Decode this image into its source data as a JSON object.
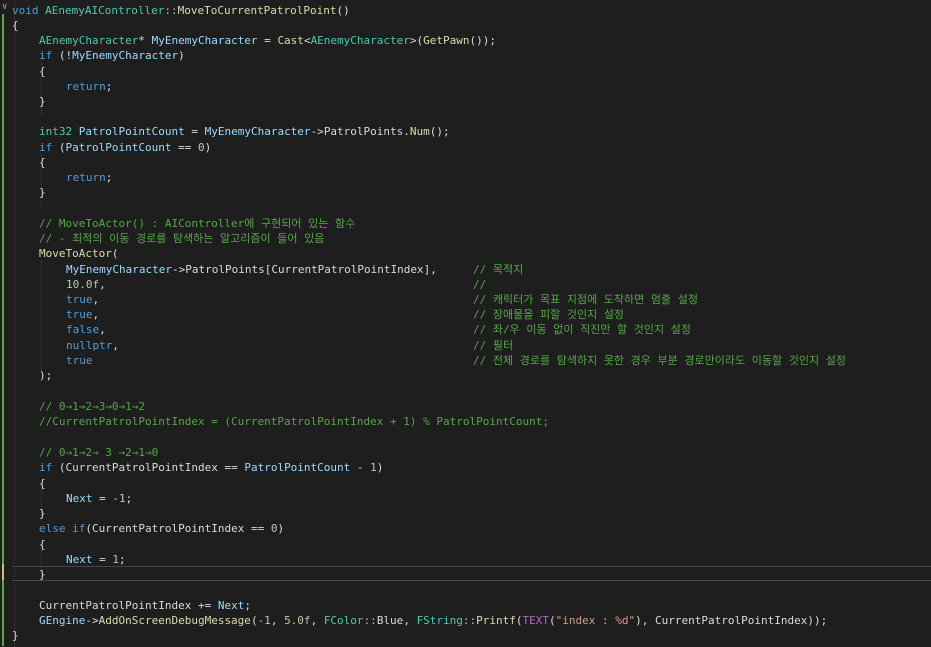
{
  "code": {
    "header": {
      "kw_void": "void",
      "class_name": "AEnemyAIController",
      "scope": "::",
      "func_name": "MoveToCurrentPatrolPoint",
      "parens": "()"
    },
    "lines": {
      "l1_brace": "{",
      "l3_type": "AEnemyCharacter",
      "l3_star": "*",
      "l3_var": "MyEnemyCharacter",
      "l3_eq": " = ",
      "l3_cast": "Cast",
      "l3_lt": "<",
      "l3_type2": "AEnemyCharacter",
      "l3_gt": ">",
      "l3_open": "(",
      "l3_getpawn": "GetPawn",
      "l3_close": "());",
      "l4_if": "if",
      "l4_open": " (!",
      "l4_var": "MyEnemyCharacter",
      "l4_close": ")",
      "l5_brace": "{",
      "l6_return": "return",
      "l6_semi": ";",
      "l7_brace": "}",
      "l9_int32": "int32",
      "l9_var": "PatrolPointCount",
      "l9_eq": " = ",
      "l9_obj": "MyEnemyCharacter",
      "l9_arrow": "->",
      "l9_mem": "PatrolPoints",
      "l9_dot": ".",
      "l9_num": "Num",
      "l9_end": "();",
      "l10_if": "if",
      "l10_open": " (",
      "l10_var": "PatrolPointCount",
      "l10_op": " == ",
      "l10_zero": "0",
      "l10_close": ")",
      "l11_brace": "{",
      "l12_return": "return",
      "l12_semi": ";",
      "l13_brace": "}",
      "l15_comment": "// MoveToActor() : AIController에 구현되어 있는 함수",
      "l16_comment": "// - 최적의 이동 경로를 탐색하는 알고리즘이 들어 있음",
      "l17_fn": "MoveToActor",
      "l17_open": "(",
      "l18_obj": "MyEnemyCharacter",
      "l18_arrow": "->",
      "l18_mem": "PatrolPoints",
      "l18_br1": "[",
      "l18_mem2": "CurrentPatrolPointIndex",
      "l18_br2": "],",
      "l18_comment": "// 목적지",
      "l19_num": "10.0f",
      "l19_comma": ",",
      "l19_comment": "//",
      "l20_kw": "true",
      "l20_comma": ",",
      "l20_comment": "// 캐릭터가 목표 지점에 도착하면 멈출 설정",
      "l21_kw": "true",
      "l21_comma": ",",
      "l21_comment": "// 장애물을 피할 것인지 설정",
      "l22_kw": "false",
      "l22_comma": ",",
      "l22_comment": "// 좌/우 이동 없이 직진만 할 것인지 설정",
      "l23_kw": "nullptr",
      "l23_comma": ",",
      "l23_comment": "// 필터",
      "l24_kw": "true",
      "l24_comment": "// 전체 경로를 탐색하지 못한 경우 부분 경로만이라도 이동할 것인지 설정",
      "l25_close": ");",
      "l27_comment": "// 0→1→2→3→0→1→2",
      "l28_comment": "//CurrentPatrolPointIndex = (CurrentPatrolPointIndex + 1) % PatrolPointCount;",
      "l30_comment": "// 0→1→2→ 3 →2→1→0",
      "l31_if": "if",
      "l31_open": " (",
      "l31_mem": "CurrentPatrolPointIndex",
      "l31_op": " == ",
      "l31_var": "PatrolPointCount",
      "l31_minus": " - ",
      "l31_one": "1",
      "l31_close": ")",
      "l32_brace": "{",
      "l33_var": "Next",
      "l33_eq": " = ",
      "l33_num": "-1",
      "l33_semi": ";",
      "l34_brace": "}",
      "l35_else": "else",
      "l35_if": "if",
      "l35_open": "(",
      "l35_mem": "CurrentPatrolPointIndex",
      "l35_op": " == ",
      "l35_zero": "0",
      "l35_close": ")",
      "l36_brace": "{",
      "l37_var": "Next",
      "l37_eq": " = ",
      "l37_num": "1",
      "l37_semi": ";",
      "l38_brace": "}",
      "l40_mem": "CurrentPatrolPointIndex",
      "l40_op": " += ",
      "l40_var": "Next",
      "l40_semi": ";",
      "l41_gengine": "GEngine",
      "l41_arrow": "->",
      "l41_fn": "AddOnScreenDebugMessage",
      "l41_open": "(",
      "l41_n1": "-1",
      "l41_c1": ", ",
      "l41_n2": "5.0f",
      "l41_c2": ", ",
      "l41_fcolor": "FColor",
      "l41_scope": "::",
      "l41_blue": "Blue",
      "l41_c3": ", ",
      "l41_fstring": "FString",
      "l41_scope2": "::",
      "l41_printf": "Printf",
      "l41_open2": "(",
      "l41_text": "TEXT",
      "l41_open3": "(",
      "l41_str": "\"index : %d\"",
      "l41_close3": "), ",
      "l41_mem": "CurrentPatrolPointIndex",
      "l41_end": "));",
      "l42_brace": "}"
    }
  },
  "colors": {
    "background": "#1e1e1e",
    "keyword": "#569cd6",
    "type": "#4ec9b0",
    "function": "#dcdcaa",
    "comment": "#57a64a",
    "number": "#b5cea8",
    "string": "#d69d85",
    "macro": "#bd63c5",
    "change_bar_saved": "#57a64a",
    "change_bar_unsaved": "#d7ba7d"
  },
  "icons": {
    "fold": "collapse-chevron-icon"
  }
}
